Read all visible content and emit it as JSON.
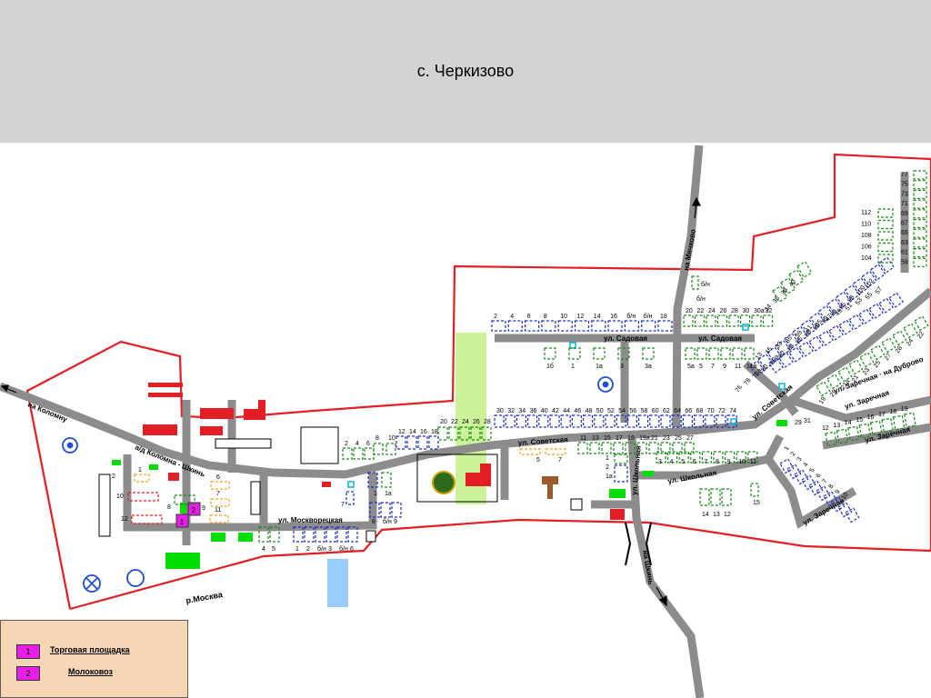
{
  "title": "с. Черкизово",
  "colors": {
    "boundary": "#e31e24",
    "road": "#8c8c8c",
    "header": "#d3d3d3",
    "legend_bg": "#f7d6b5",
    "marker_magenta": "#e81ee8",
    "green_zone": "#ccf29a",
    "water": "#99ccff",
    "house_blue": "#1e2ec8",
    "house_green": "#1a8a1a"
  },
  "roads": {
    "kolomna_shkin": "а/д Коломна - Шкинь",
    "to_kolomnu": "на Коломну",
    "to_mochevo": "на Мячково",
    "to_shkin": "на Шкинь",
    "sovetskaya": "ул. Советская",
    "sovetskaya_east": "ул. Советская",
    "sadovaya_west": "ул. Садовая",
    "sadovaya_east": "ул. Садовая",
    "shkolnaya": "ул. Школьная",
    "shkolnaya_vertical": "ул. Школьная",
    "moskvoretskaya": "ул. Москворецкая",
    "zarechnaya_1": "ул. Заречная",
    "zarechnaya_dubrovo": "ул. Заречная · на Дуброво",
    "zarechnaya_2": "ул. Заречная",
    "zarechnaya_3": "ул. Заречная"
  },
  "river": "р.Москва",
  "house_numbers": {
    "sadovaya_top": [
      "2",
      "4",
      "6",
      "8",
      "10",
      "12",
      "14",
      "16",
      "б/н",
      "б/н",
      "18"
    ],
    "sadovaya_bottom": [
      "1б",
      "1",
      "1а",
      "3",
      "3а"
    ],
    "sadovaya_east_top": [
      "20",
      "22",
      "24",
      "26",
      "28",
      "30",
      "30а",
      "32"
    ],
    "sadovaya_east_bottom": [
      "5а",
      "5",
      "7",
      "9",
      "11",
      "11а"
    ],
    "bn_upper": [
      "б/н",
      "б/н"
    ],
    "sovetskaya_top": [
      "30",
      "32",
      "34",
      "36",
      "40",
      "42",
      "44",
      "46",
      "48",
      "50",
      "52",
      "54",
      "56",
      "58",
      "60",
      "62",
      "64",
      "66",
      "68",
      "70",
      "72",
      "74"
    ],
    "sovetskaya_left": [
      "20",
      "22",
      "24",
      "26",
      "28",
      "12",
      "14",
      "16",
      "18",
      "8",
      "10",
      "2",
      "4",
      "6"
    ],
    "sovetskaya_bottom": [
      "11",
      "13",
      "15",
      "17",
      "19",
      "19а",
      "21",
      "23",
      "25",
      "27"
    ],
    "shkolnaya": [
      "3",
      "4",
      "5",
      "6",
      "7",
      "8",
      "9",
      "10",
      "11",
      "14",
      "13",
      "12",
      "15",
      "1",
      "2",
      "1а"
    ],
    "moskvoretskaya": [
      "4",
      "5",
      "1",
      "2",
      "б/н",
      "3",
      "б/н",
      "6",
      "8",
      "б/н",
      "9",
      "1",
      "1а",
      "7"
    ],
    "west": [
      "1",
      "2",
      "10",
      "12",
      "6",
      "7",
      "11",
      "8",
      "9"
    ],
    "five_seven": [
      "5",
      "7"
    ],
    "east_vertical": [
      "77",
      "75",
      "73",
      "71",
      "69",
      "67",
      "65",
      "63",
      "61",
      "59"
    ],
    "east_left": [
      "112",
      "110",
      "108",
      "106",
      "104"
    ],
    "diagonal_1": [
      "34",
      "36",
      "38",
      "40"
    ],
    "diagonal_2": [
      "76",
      "78",
      "78а",
      "80",
      "80а",
      "82",
      "84",
      "86",
      "88",
      "90",
      "92",
      "94",
      "96",
      "98",
      "100",
      "102"
    ],
    "diagonal_3": [
      "13",
      "15",
      "33",
      "35",
      "39",
      "41",
      "45",
      "47",
      "49",
      "51",
      "53",
      "55",
      "57"
    ],
    "dubrovo": [
      "19",
      "29",
      "21а",
      "21",
      "23",
      "25",
      "27",
      "28",
      "24",
      "22"
    ],
    "zarechnaya_row": [
      "12",
      "13",
      "14",
      "15",
      "16",
      "17",
      "18",
      "19"
    ],
    "zarechnaya_lower": [
      "1",
      "2",
      "3",
      "4",
      "5",
      "6",
      "7",
      "8",
      "9",
      "10"
    ],
    "misc": [
      "29",
      "31"
    ]
  },
  "legend": [
    {
      "id": "1",
      "label": "Торговая площадка"
    },
    {
      "id": "2",
      "label": "Молоковоз"
    }
  ]
}
